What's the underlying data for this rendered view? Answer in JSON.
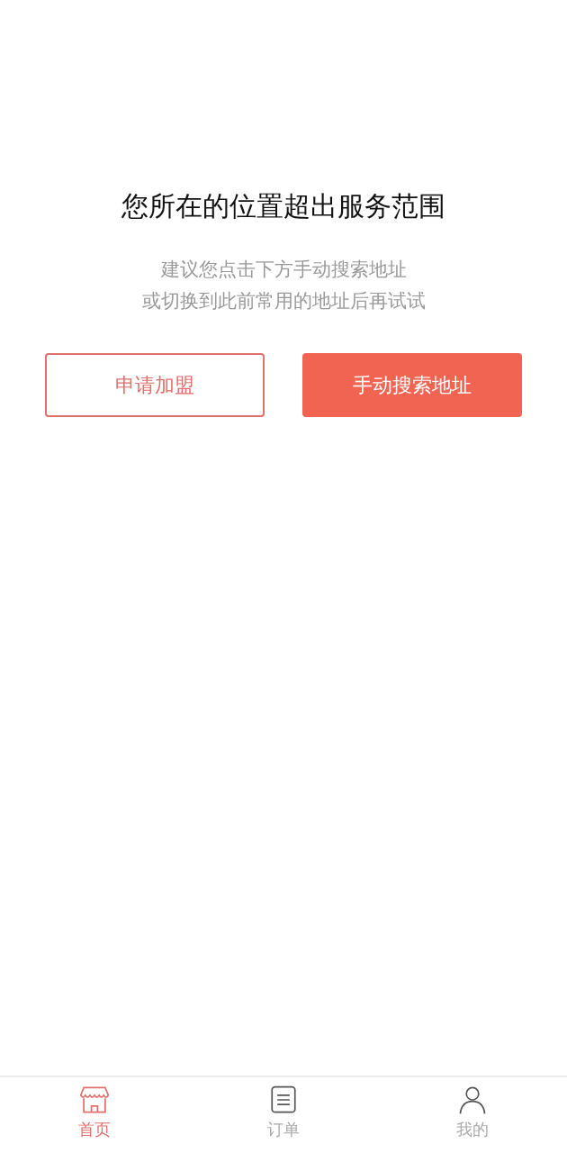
{
  "message": {
    "title": "您所在的位置超出服务范围",
    "lines": [
      "建议您点击下方手动搜索地址",
      "或切换到此前常用的地址后再试试"
    ]
  },
  "buttons": [
    {
      "label": "申请加盟",
      "kind": "outline"
    },
    {
      "label": "手动搜索地址",
      "kind": "filled"
    }
  ],
  "tab_bar": [
    {
      "label": "首页",
      "kind": "store",
      "selected": true
    },
    {
      "label": "订单",
      "kind": "list",
      "selected": false
    },
    {
      "label": "我的",
      "kind": "person",
      "selected": false
    }
  ]
}
